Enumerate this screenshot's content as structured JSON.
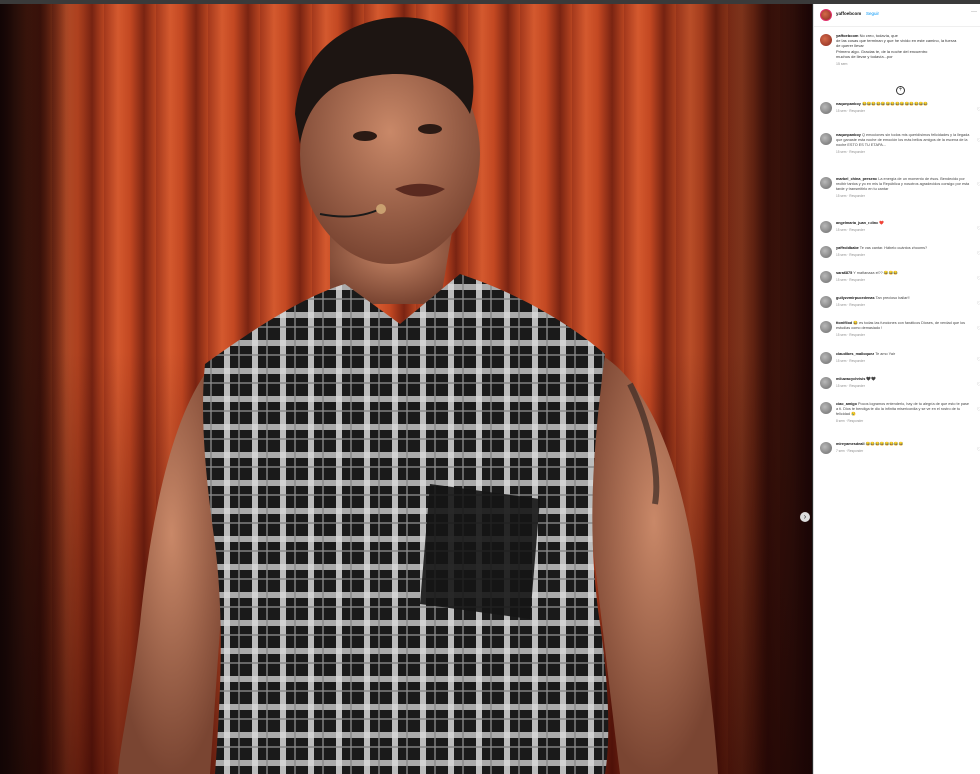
{
  "post": {
    "username": "yaffoebcom",
    "follow_label": "Seguir",
    "more": "···",
    "caption_lines": [
      "No creo, todavía, que",
      "de las cosas que terminan y que he vivido en este camino, la fuerza",
      "de querer llevar",
      "Primero algo. Gracias te, de la noche del encuentro",
      "muchos de llevar y todavía...por"
    ],
    "caption_time": "15 sem",
    "load_more": "+"
  },
  "comments": [
    {
      "user": "naqunpanboy",
      "text": "😂😂😂😂😂😂😂😂😂😂😂😂😂😂",
      "time": "15 sem",
      "reply": "Responder"
    },
    {
      "user": "naqunpanboy",
      "text": "Q emociones sin todos mis queridísimos felicidades y la llegada que ganaste esta noche de emoción los más bellos amigos de la escena de la noche ESTO ES TU ETAPA...",
      "time": "15 sem",
      "reply": "Responder"
    },
    {
      "user": "marbel_china_presenc",
      "text": "La energía de un momento de ésos. Bendecido por recibir tantos y yo en mis la República y nosotros agradecidos consigo por esta tarde y transmitirlo en tu cantar",
      "time": "15 sem",
      "reply": "Responder"
    },
    {
      "user": "angelmaria_juan_r.dinc",
      "text": "❤️",
      "time": "15 sem",
      "reply": "Responder"
    },
    {
      "user": "yaffroldbabe",
      "text": "Te vas cantar. Hábelo cuántos zhooms?",
      "time": "15 sem",
      "reply": "Responder"
    },
    {
      "user": "sara6875",
      "text": "Y mañanaza el?? 😂😂😂",
      "time": "15 sem",
      "reply": "Responder"
    },
    {
      "user": "guilyzvmirpucedenas",
      "text": "Tan precioso bailar!!",
      "time": "15 sem",
      "reply": "Responder"
    },
    {
      "user": "ttonifilod",
      "text": "😂 es todas las funciones con fanáticos Dioses, de verdad que los estudias como demasiado !",
      "time": "15 sem",
      "reply": "Responder"
    },
    {
      "user": "claudibes_malloquez",
      "text": "Te amo Yair",
      "time": "15 sem",
      "reply": "Responder"
    },
    {
      "user": "miluwacychrisis",
      "text": "🖤🖤",
      "time": "15 sem",
      "reply": "Responder"
    },
    {
      "user": "ciao_amigo",
      "text": "Pocos logramos entenderlo, hay de tu alegría de que esto te pase a ti. Dios te bendiga te dio la infinita misericordia y se ve en el rostro de tu felicidad 😢",
      "time": "8 sem",
      "reply": "Responder"
    },
    {
      "user": "mireyamesdeall",
      "text": "😂😂😂😂😂😂😂😂",
      "time": "7 sem",
      "reply": "Responder"
    }
  ],
  "photo": {
    "description_icon": "next-arrow-icon"
  }
}
